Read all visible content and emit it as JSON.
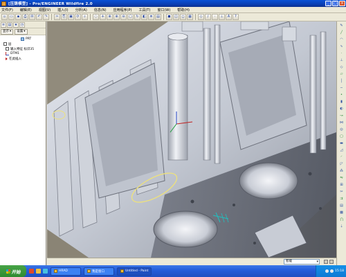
{
  "window": {
    "title": "[压铸模型] - Pro/ENGINEER Wildfire 2.0",
    "controls": [
      "_",
      "□",
      "×"
    ]
  },
  "menubar": {
    "items": [
      "文件(F)",
      "编辑(E)",
      "视图(V)",
      "插入(I)",
      "分析(A)",
      "信息(N)",
      "应用程序(P)",
      "工具(T)",
      "窗口(W)",
      "帮助(H)"
    ]
  },
  "toolbar": {
    "icons": [
      "new-icon",
      "open-icon",
      "save-icon",
      "print-icon",
      "email-icon",
      "undo-icon",
      "redo-icon",
      "cut-icon",
      "copy-icon",
      "paste-icon",
      "regenerate-icon",
      "search-icon",
      "repaint-icon",
      "spin-center-icon",
      "orient-icon",
      "zoom-in-icon",
      "zoom-out-icon",
      "refit-icon",
      "reorient-icon",
      "saved-views-icon",
      "layers-icon",
      "view-manager-icon",
      "shading-icon",
      "hidden-line-icon",
      "no-hidden-icon",
      "wireframe-icon",
      "datum-planes-icon",
      "datum-axes-icon",
      "datum-points-icon",
      "coord-sys-icon",
      "annotations-icon",
      "help-icon"
    ]
  },
  "left_panel": {
    "tabs": [
      {
        "label": "显示",
        "icon": "show-icon"
      },
      {
        "label": "设置",
        "icon": "settings-icon"
      }
    ],
    "tree": {
      "root": "PRT",
      "items": [
        {
          "label": "层",
          "icon": "layer"
        },
        {
          "label": "输入特征 标识35",
          "icon": "part"
        },
        {
          "label": "DTM1",
          "icon": "csys"
        },
        {
          "label": "在此插入",
          "icon": "insert"
        }
      ]
    }
  },
  "right_toolbar": {
    "icons": [
      "sketch-icon",
      "line-icon",
      "arc-icon",
      "spline-icon",
      "point-icon",
      "csys-icon",
      "datum-icon",
      "plane-icon",
      "axis-icon",
      "curve-icon",
      "point2-icon",
      "extrude-icon",
      "revolve-icon",
      "sweep-icon",
      "blend-icon",
      "hole-icon",
      "shell-icon",
      "rib-icon",
      "draft-icon",
      "round-icon",
      "chamfer-icon",
      "pattern-icon",
      "mirror-icon",
      "merge-icon",
      "trim-icon",
      "offset-icon",
      "thicken-icon",
      "solidify-icon",
      "intersect-icon",
      "project-icon"
    ]
  },
  "status": {
    "filter": "智能"
  },
  "taskbar": {
    "start_label": "开始",
    "tasks": [
      {
        "label": "HRAD",
        "active": false
      },
      {
        "label": "我是窗口",
        "active": false
      },
      {
        "label": "Untitled - Paint",
        "active": true
      }
    ],
    "clock": "15:18"
  },
  "colors": {
    "viewport_bg": "#8c8577",
    "model_light": "#dcdfe6",
    "model_mid": "#b4b9c4",
    "model_dark": "#5b5f6a",
    "highlight": "#f0e060",
    "axis_red": "#c02020",
    "axis_cyan": "#20c0c0"
  }
}
